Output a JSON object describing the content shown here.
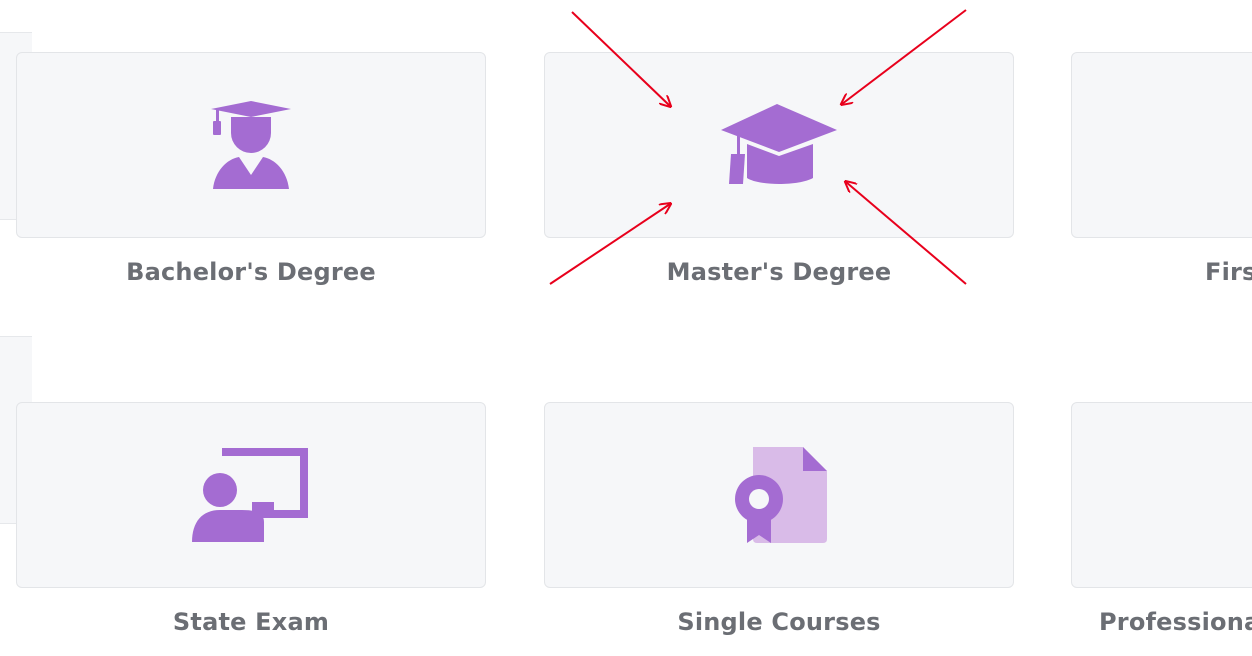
{
  "colors": {
    "tile_bg": "#f6f7f9",
    "tile_border": "#e3e5e8",
    "icon_purple": "#a46cd2",
    "icon_purple_light": "#d9bbe8",
    "label_gray": "#6b6e74",
    "annotation_red": "#e8001c"
  },
  "categories": [
    {
      "label": "Bachelor's Degree",
      "icon": "graduate-student-icon"
    },
    {
      "label": "Master's Degree",
      "icon": "graduation-cap-icon"
    },
    {
      "label": "Firs",
      "icon": ""
    },
    {
      "label": "State Exam",
      "icon": "teacher-board-icon"
    },
    {
      "label": "Single Courses",
      "icon": "certificate-document-icon"
    },
    {
      "label": "Professiona",
      "icon": ""
    }
  ],
  "annotations": {
    "type": "red-arrows",
    "count": 4,
    "target": "Master's Degree"
  }
}
